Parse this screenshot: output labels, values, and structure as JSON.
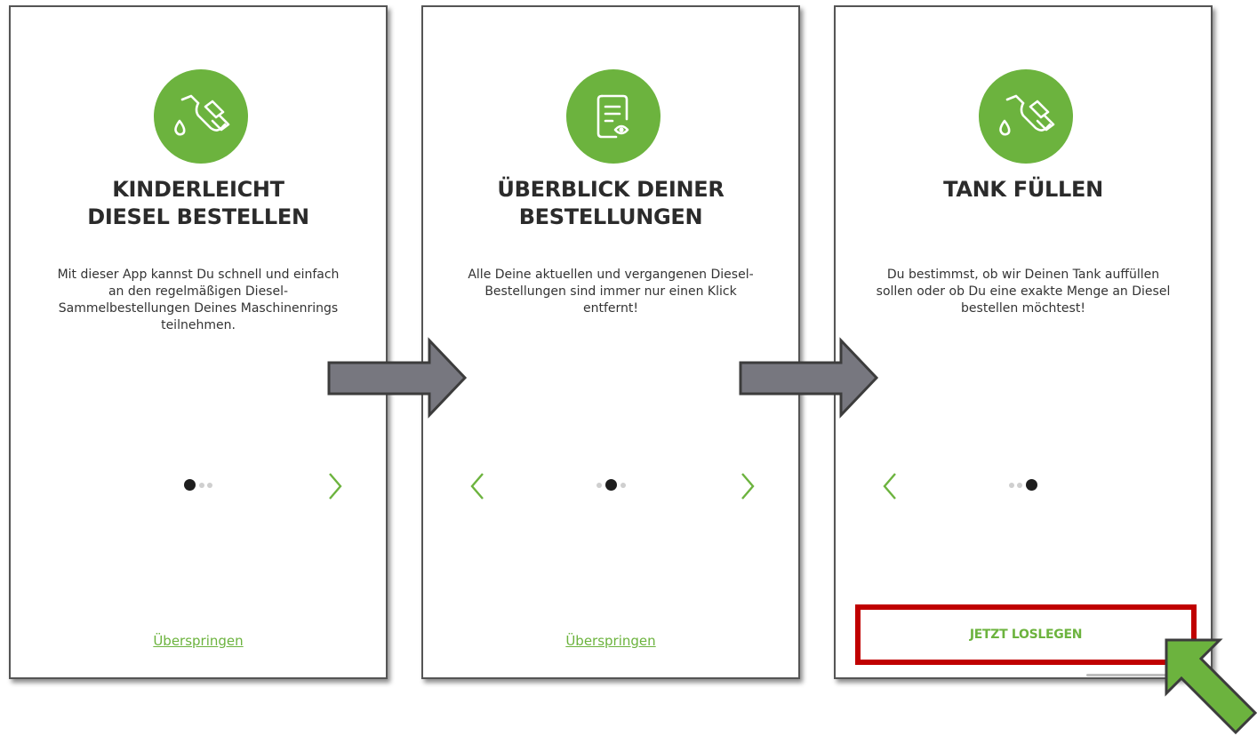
{
  "screens": [
    {
      "icon": "fuel-nozzle-icon",
      "title_line1": "KINDERLEICHT",
      "title_line2": "DIESEL BESTELLEN",
      "desc_line1": "Mit dieser App kannst Du schnell und einfach",
      "desc_line2": "an den regelmäßigen Diesel-",
      "desc_line3": "Sammelbestellungen Deines Maschinenrings",
      "desc_line4": "teilnehmen.",
      "skip_label": "Überspringen",
      "page_indicator": "1 of 3"
    },
    {
      "icon": "document-view-icon",
      "title_line1": "ÜBERBLICK DEINER",
      "title_line2": "BESTELLUNGEN",
      "desc_line1": "Alle Deine aktuellen und vergangenen Diesel-",
      "desc_line2": "Bestellungen sind immer nur einen Klick",
      "desc_line3": "entfernt!",
      "skip_label": "Überspringen",
      "page_indicator": "2 of 3"
    },
    {
      "icon": "fuel-nozzle-icon",
      "title_line1": "TANK FÜLLEN",
      "desc_line1": "Du bestimmst, ob wir Deinen Tank auffüllen",
      "desc_line2": "sollen oder ob Du eine exakte Menge an Diesel",
      "desc_line3": "bestellen möchtest!",
      "cta_label": "JETZT LOSLEGEN",
      "page_indicator": "3 of 3"
    }
  ],
  "colors": {
    "accent_green": "#6cb33e",
    "highlight_red": "#c00000",
    "flow_arrow_gray": "#77777f",
    "pointer_arrow_green": "#6cb33e"
  }
}
